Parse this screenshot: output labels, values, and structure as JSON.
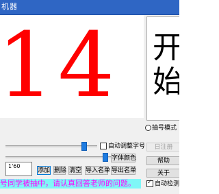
{
  "window": {
    "title": "机器"
  },
  "display": {
    "current_number": "14",
    "preview_text": "开\n始"
  },
  "modes": {
    "draw_mode_label": "抽号模式",
    "selected": "draw_mode"
  },
  "controls": {
    "auto_font_label": "自动调整字号",
    "auto_font_checked": false,
    "font_color_label": "字体颜色",
    "time_value": "1'60",
    "font_size_slider_value": 0.88,
    "color_slider_value": 0.97
  },
  "buttons": {
    "add": "添加",
    "delete": "删除",
    "clear": "清空",
    "import": "导入名单",
    "export": "导出名单",
    "side_top": "日注册",
    "help": "帮助",
    "about": "关于"
  },
  "auto_check": {
    "label": "自动检测新",
    "checked": true
  },
  "message": "号同学被抽中，请认真回答老师的问题。"
}
